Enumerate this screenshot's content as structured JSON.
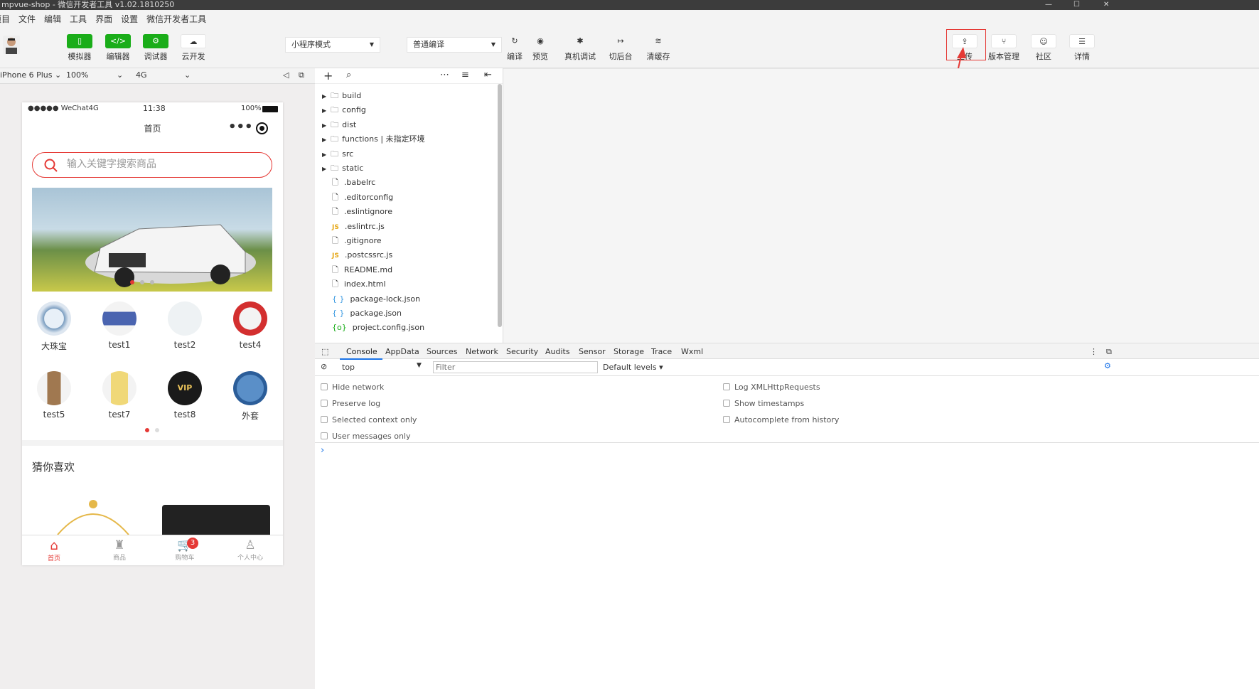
{
  "window": {
    "title": "mpvue-shop - 微信开发者工具 v1.02.1810250"
  },
  "menu": [
    "项目",
    "文件",
    "编辑",
    "工具",
    "界面",
    "设置",
    "微信开发者工具"
  ],
  "toolbar": {
    "left": [
      {
        "label": "模拟器",
        "icon": "phone-icon",
        "glyph": "▯"
      },
      {
        "label": "编辑器",
        "icon": "code-icon",
        "glyph": "</>"
      },
      {
        "label": "调试器",
        "icon": "debug-icon",
        "glyph": "⚙"
      },
      {
        "label": "云开发",
        "icon": "cloud-icon",
        "glyph": "☁"
      }
    ],
    "mode_select": "小程序模式",
    "compile_select": "普通编译",
    "mid": [
      {
        "label": "编译",
        "glyph": "↻"
      },
      {
        "label": "预览",
        "glyph": "◉"
      },
      {
        "label": "真机调试",
        "glyph": "✱"
      },
      {
        "label": "切后台",
        "glyph": "↦"
      },
      {
        "label": "清缓存",
        "glyph": "≋"
      }
    ],
    "right": [
      {
        "label": "上传",
        "glyph": "⇪"
      },
      {
        "label": "版本管理",
        "glyph": "⑂"
      },
      {
        "label": "社区",
        "glyph": "☺"
      },
      {
        "label": "详情",
        "glyph": "☰"
      }
    ]
  },
  "simulator": {
    "device": "iPhone 6 Plus",
    "zoom": "100%",
    "network": "4G",
    "status_carrier": "●●●●● WeChat4G",
    "status_time": "11:38",
    "status_battery": "100%",
    "nav_title": "首页",
    "search_placeholder": "输入关键字搜索商品",
    "grid": [
      "大珠宝",
      "test1",
      "test2",
      "test4",
      "test5",
      "test7",
      "test8",
      "外套"
    ],
    "section_title": "猜你喜欢",
    "tabs": [
      "首页",
      "商品",
      "购物车",
      "个人中心"
    ],
    "cart_badge": "3"
  },
  "explorer": {
    "folders": [
      "build",
      "config",
      "dist",
      "functions | 未指定环境",
      "src",
      "static"
    ],
    "files": [
      {
        "name": ".babelrc",
        "type": "file"
      },
      {
        "name": ".editorconfig",
        "type": "file"
      },
      {
        "name": ".eslintignore",
        "type": "file"
      },
      {
        "name": ".eslintrc.js",
        "type": "js"
      },
      {
        "name": ".gitignore",
        "type": "file"
      },
      {
        "name": ".postcssrc.js",
        "type": "js"
      },
      {
        "name": "README.md",
        "type": "file"
      },
      {
        "name": "index.html",
        "type": "file"
      },
      {
        "name": "package-lock.json",
        "type": "json"
      },
      {
        "name": "package.json",
        "type": "json"
      },
      {
        "name": "project.config.json",
        "type": "config"
      }
    ]
  },
  "devtools": {
    "tabs": [
      "Console",
      "AppData",
      "Sources",
      "Network",
      "Security",
      "Audits",
      "Sensor",
      "Storage",
      "Trace",
      "Wxml"
    ],
    "context": "top",
    "filter_placeholder": "Filter",
    "levels": "Default levels",
    "left_opts": [
      "Hide network",
      "Preserve log",
      "Selected context only",
      "User messages only"
    ],
    "right_opts": [
      "Log XMLHttpRequests",
      "Show timestamps",
      "Autocomplete from history"
    ],
    "prompt": "›"
  }
}
